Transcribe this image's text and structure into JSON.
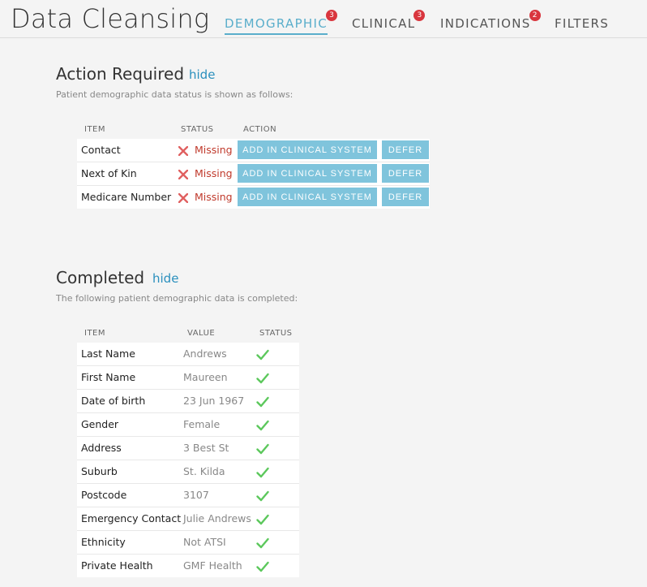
{
  "header": {
    "title": "Data Cleansing",
    "tabs": [
      {
        "label": "DEMOGRAPHIC",
        "badge": "3"
      },
      {
        "label": "CLINICAL",
        "badge": "3"
      },
      {
        "label": "INDICATIONS",
        "badge": "2"
      },
      {
        "label": "FILTERS"
      }
    ]
  },
  "action_required": {
    "title": "Action Required",
    "hide_label": "hide",
    "description": "Patient demographic data status is shown as follows:",
    "columns": [
      "ITEM",
      "STATUS",
      "ACTION"
    ],
    "add_label": "ADD IN CLINICAL SYSTEM",
    "defer_label": "DEFER",
    "rows": [
      {
        "item": "Contact",
        "status": "Missing"
      },
      {
        "item": "Next of Kin",
        "status": "Missing"
      },
      {
        "item": "Medicare Number",
        "status": "Missing"
      }
    ]
  },
  "completed": {
    "title": "Completed",
    "hide_label": "hide",
    "description": "The following patient demographic data is completed:",
    "columns": [
      "ITEM",
      "VALUE",
      "STATUS"
    ],
    "rows": [
      {
        "item": "Last Name",
        "value": "Andrews"
      },
      {
        "item": "First Name",
        "value": "Maureen"
      },
      {
        "item": "Date of birth",
        "value": "23 Jun 1967"
      },
      {
        "item": "Gender",
        "value": "Female"
      },
      {
        "item": "Address",
        "value": "3 Best St"
      },
      {
        "item": "Suburb",
        "value": "St. Kilda"
      },
      {
        "item": "Postcode",
        "value": "3107"
      },
      {
        "item": "Emergency Contact",
        "value": "Julie Andrews"
      },
      {
        "item": "Ethnicity",
        "value": "Not ATSI"
      },
      {
        "item": "Private Health",
        "value": "GMF Health"
      }
    ]
  },
  "colors": {
    "accent": "#5aaecb",
    "button": "#7fc4dc",
    "badge": "#d9363e",
    "missing": "#c0392b",
    "check": "#5cc85c"
  }
}
